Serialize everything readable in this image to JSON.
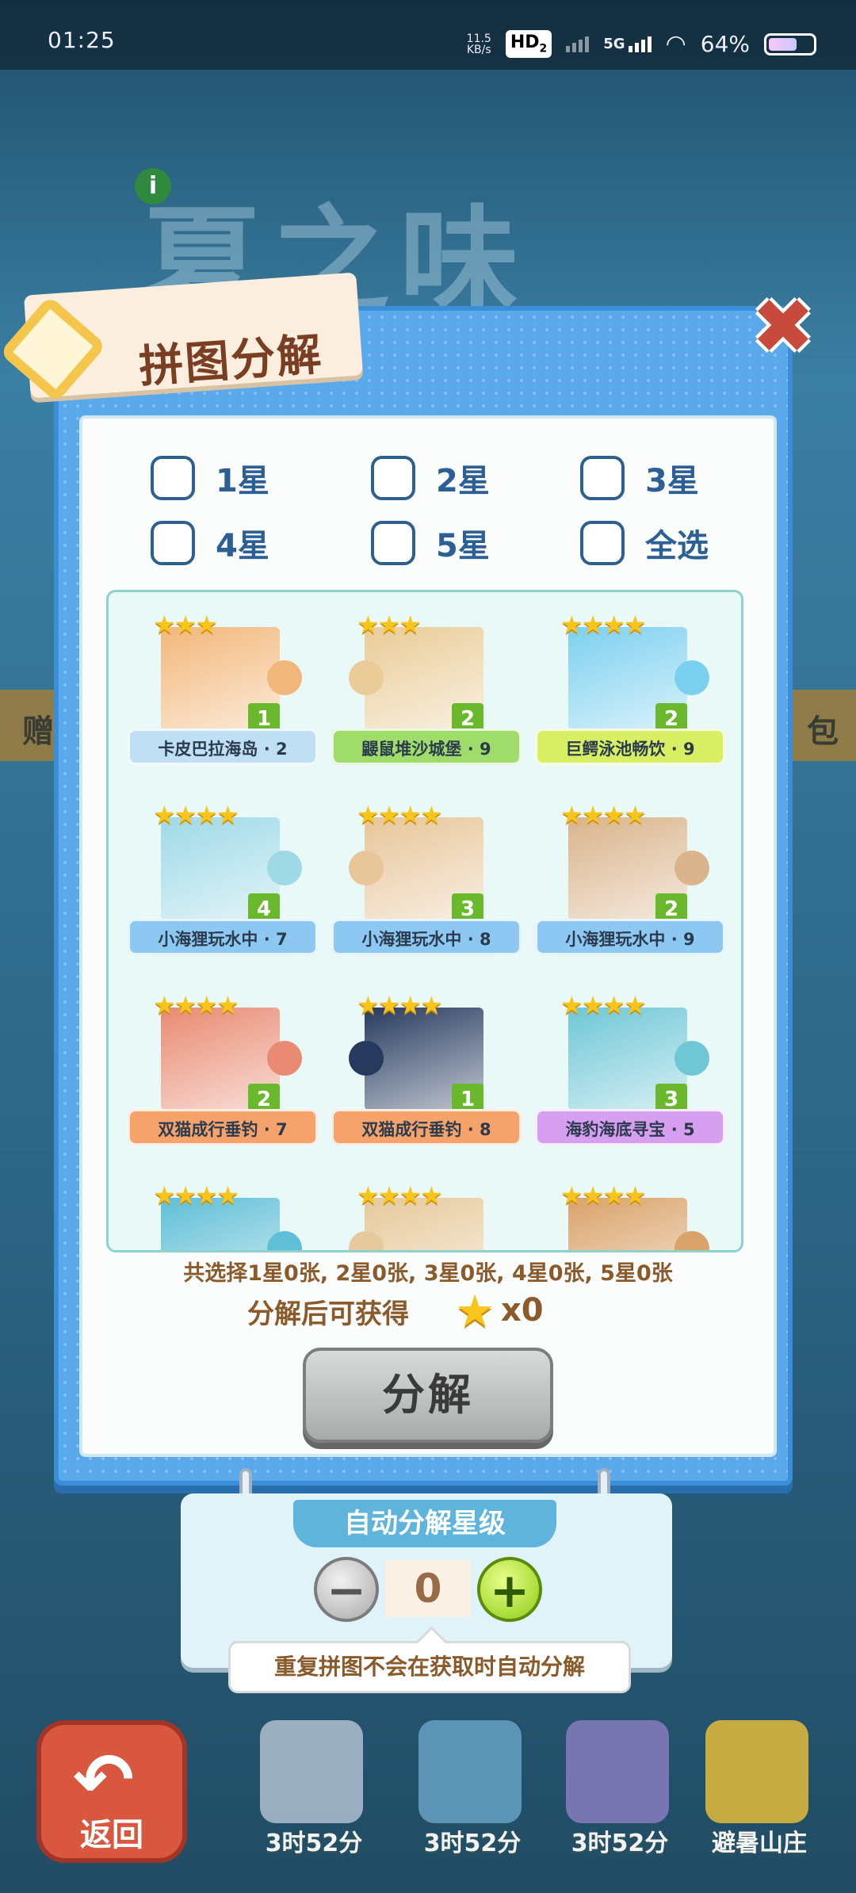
{
  "status_bar": {
    "time": "01:25",
    "net_speed_value": "11.5",
    "net_speed_unit": "KB/s",
    "hd_badge": "HD",
    "hd_sub": "2",
    "signal_label": "5G",
    "battery": "64%"
  },
  "background": {
    "title": "夏之味",
    "strip_left": "赠",
    "strip_right": "包"
  },
  "modal": {
    "title": "拼图分解",
    "filters": [
      "1星",
      "2星",
      "3星",
      "4星",
      "5星",
      "全选"
    ],
    "pieces": [
      {
        "name": "卡皮巴拉海岛 · 2",
        "stars": "★★★",
        "count": "1",
        "ribbon": "#bfe0f4",
        "thumb": "#f2b77a"
      },
      {
        "name": "鼹鼠堆沙城堡 · 9",
        "stars": "★★★",
        "count": "2",
        "ribbon": "#9fdc6a",
        "thumb": "#e9cc98"
      },
      {
        "name": "巨鳄泳池畅饮 · 9",
        "stars": "★★★★",
        "count": "2",
        "ribbon": "#d8ef63",
        "thumb": "#7cd0ef"
      },
      {
        "name": "小海狸玩水中 · 7",
        "stars": "★★★★",
        "count": "4",
        "ribbon": "#8cc8f1",
        "thumb": "#9ed9e6"
      },
      {
        "name": "小海狸玩水中 · 8",
        "stars": "★★★★",
        "count": "3",
        "ribbon": "#8cc8f1",
        "thumb": "#e7c69a"
      },
      {
        "name": "小海狸玩水中 · 9",
        "stars": "★★★★",
        "count": "2",
        "ribbon": "#8cc8f1",
        "thumb": "#d9b48c"
      },
      {
        "name": "双猫成行垂钓 · 7",
        "stars": "★★★★",
        "count": "2",
        "ribbon": "#f6a26b",
        "thumb": "#e98a72"
      },
      {
        "name": "双猫成行垂钓 · 8",
        "stars": "★★★★",
        "count": "1",
        "ribbon": "#f6a26b",
        "thumb": "#273a5e"
      },
      {
        "name": "海豹海底寻宝 · 5",
        "stars": "★★★★",
        "count": "3",
        "ribbon": "#d79ff0",
        "thumb": "#6fc7d6"
      },
      {
        "name": "",
        "stars": "★★★★",
        "count": "",
        "ribbon": "",
        "thumb": "#5fbfd6"
      },
      {
        "name": "",
        "stars": "★★★★",
        "count": "",
        "ribbon": "",
        "thumb": "#e6c99c"
      },
      {
        "name": "",
        "stars": "★★★★",
        "count": "",
        "ribbon": "",
        "thumb": "#d9a36a"
      }
    ],
    "summary": "共选择1星0张, 2星0张, 3星0张, 4星0张, 5星0张",
    "gain_label": "分解后可获得",
    "gain_value": "x0",
    "decompose_label": "分解"
  },
  "auto_panel": {
    "title": "自动分解星级",
    "value": "0",
    "tip": "重复拼图不会在获取时自动分解"
  },
  "bottom": {
    "back_label": "返回",
    "items": [
      {
        "label": "3时52分",
        "color": "#b8c7d6"
      },
      {
        "label": "3时52分",
        "color": "#6aa5c8"
      },
      {
        "label": "3时52分",
        "color": "#8d7fc2"
      },
      {
        "label": "避暑山庄",
        "color": "#f0c23a"
      }
    ]
  }
}
